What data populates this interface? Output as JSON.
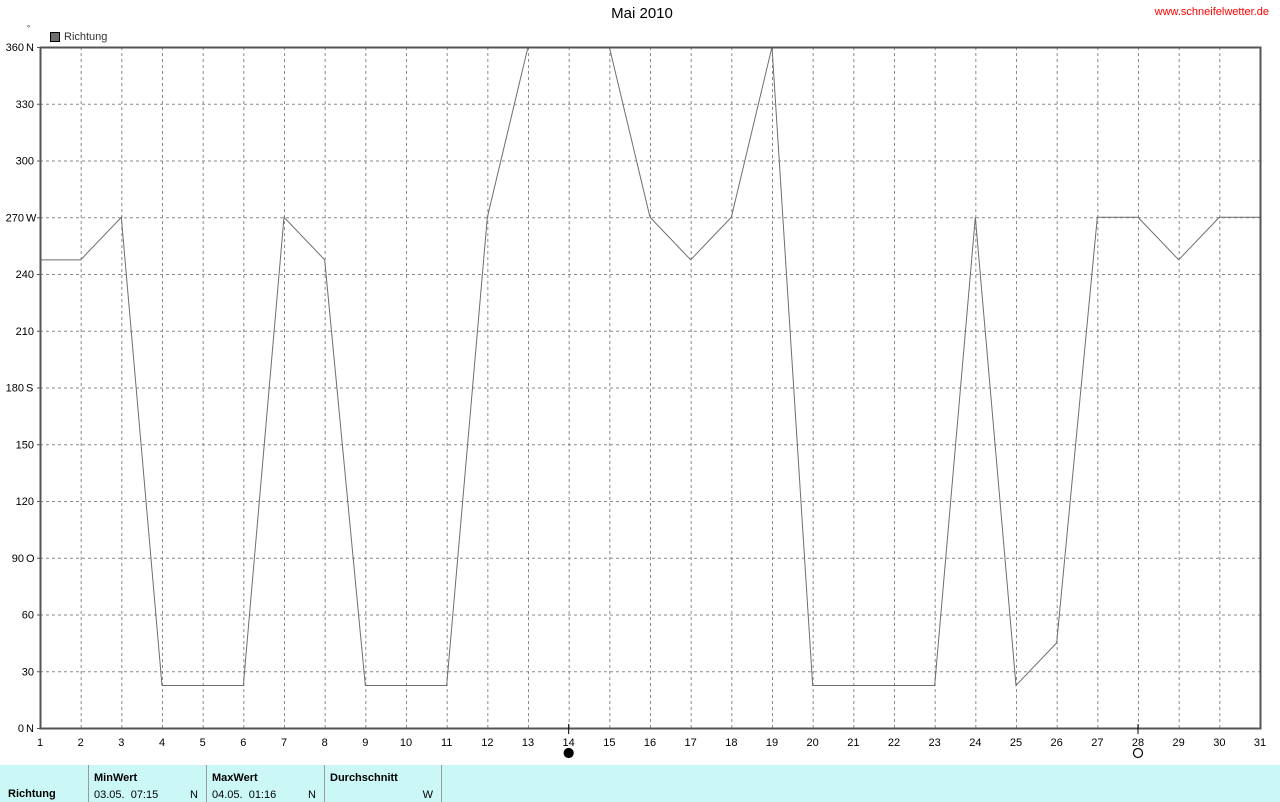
{
  "header": {
    "source": "www.schneifelwetter.de",
    "degree_unit": "°"
  },
  "chart_data": {
    "type": "line",
    "title": "Mai 2010",
    "xlabel": "",
    "ylabel": "",
    "x": [
      1,
      2,
      3,
      4,
      5,
      6,
      7,
      8,
      9,
      10,
      11,
      12,
      13,
      14,
      15,
      16,
      17,
      18,
      19,
      20,
      21,
      22,
      23,
      24,
      25,
      26,
      27,
      28,
      29,
      30,
      31
    ],
    "xlim": [
      1,
      31
    ],
    "ylim": [
      0,
      360
    ],
    "y_ticks": [
      {
        "value": 0,
        "label": "0",
        "dir": "N"
      },
      {
        "value": 30,
        "label": "30",
        "dir": ""
      },
      {
        "value": 60,
        "label": "60",
        "dir": ""
      },
      {
        "value": 90,
        "label": "90",
        "dir": "O"
      },
      {
        "value": 120,
        "label": "120",
        "dir": ""
      },
      {
        "value": 150,
        "label": "150",
        "dir": ""
      },
      {
        "value": 180,
        "label": "180",
        "dir": "S"
      },
      {
        "value": 210,
        "label": "210",
        "dir": ""
      },
      {
        "value": 240,
        "label": "240",
        "dir": ""
      },
      {
        "value": 270,
        "label": "270",
        "dir": "W"
      },
      {
        "value": 300,
        "label": "300",
        "dir": ""
      },
      {
        "value": 330,
        "label": "330",
        "dir": ""
      },
      {
        "value": 360,
        "label": "360",
        "dir": "N"
      }
    ],
    "series": [
      {
        "name": "Richtung",
        "color": "#6e6e6e",
        "segments": [
          {
            "x": [
              1,
              2,
              3,
              4,
              5,
              6,
              7,
              8,
              9,
              10,
              11,
              12,
              13
            ],
            "y": [
              247.5,
              247.5,
              270,
              22.5,
              22.5,
              22.5,
              270,
              247.5,
              22.5,
              22.5,
              22.5,
              270,
              360
            ]
          },
          {
            "x": [
              15,
              16,
              17,
              18,
              19,
              20,
              21,
              22,
              23,
              24,
              25,
              26,
              27,
              28,
              29,
              30,
              31
            ],
            "y": [
              360,
              270,
              247.5,
              270,
              360,
              22.5,
              22.5,
              22.5,
              22.5,
              270,
              22.5,
              45,
              270,
              270,
              247.5,
              270,
              270
            ]
          }
        ]
      }
    ],
    "moon_phases": [
      {
        "day": 14,
        "phase": "new-moon"
      },
      {
        "day": 28,
        "phase": "full-moon"
      }
    ],
    "grid": true,
    "legend": "top-left"
  },
  "stats": {
    "row_label": "Richtung",
    "columns": [
      {
        "head": "MinWert",
        "when": "03.05.  07:15",
        "dir": "N"
      },
      {
        "head": "MaxWert",
        "when": "04.05.  01:16",
        "dir": "N"
      },
      {
        "head": "Durchschnitt",
        "when": "",
        "dir": "W"
      }
    ]
  }
}
